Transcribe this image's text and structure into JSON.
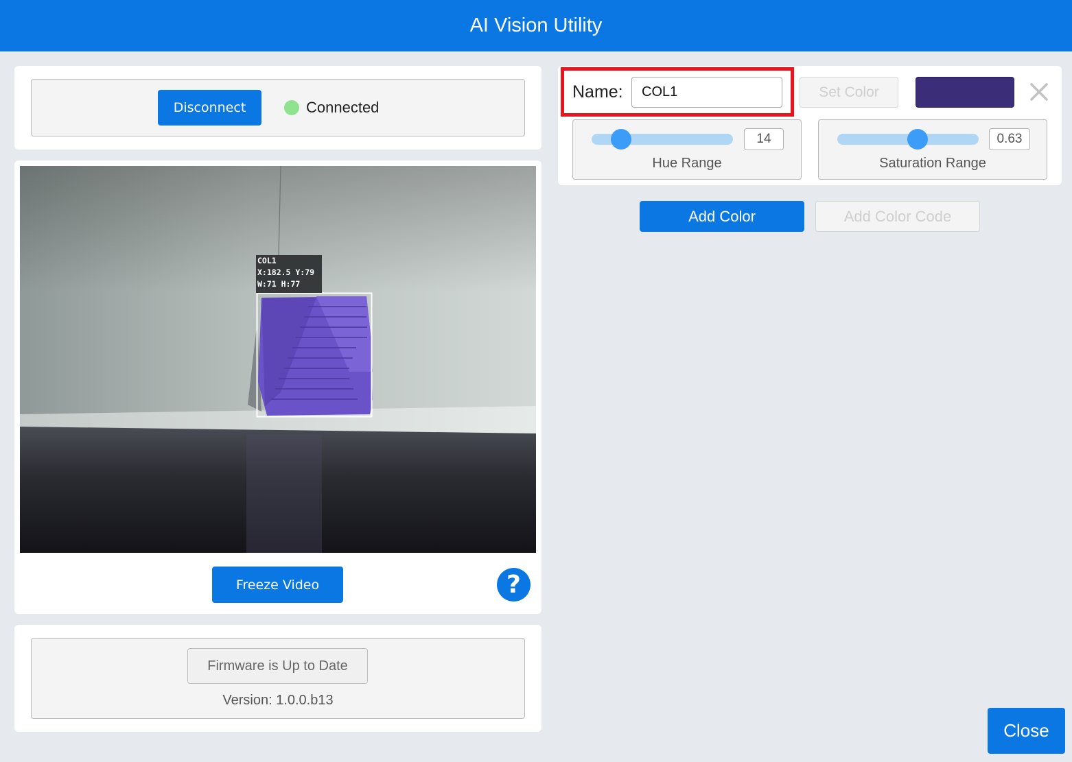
{
  "window": {
    "title": "AI Vision Utility"
  },
  "connection": {
    "disconnect_label": "Disconnect",
    "status_text": "Connected",
    "status_color": "#8fe38f"
  },
  "video": {
    "overlay_lines": [
      "COL1",
      "X:182.5 Y:79",
      "W:71 H:77"
    ],
    "freeze_label": "Freeze Video",
    "help_label": "?"
  },
  "firmware": {
    "status_label": "Firmware is Up to Date",
    "version_text": "Version: 1.0.0.b13"
  },
  "color_editor": {
    "name_label": "Name:",
    "name_value": "COL1",
    "set_color_label": "Set Color",
    "swatch_color": "#3b2d77",
    "remove_icon": "close-x-icon",
    "hue": {
      "label": "Hue Range",
      "value": "14",
      "fraction": 0.21
    },
    "saturation": {
      "label": "Saturation Range",
      "value": "0.63",
      "fraction": 0.57
    }
  },
  "actions": {
    "add_color_label": "Add Color",
    "add_color_code_label": "Add Color Code",
    "close_label": "Close"
  },
  "theme": {
    "accent": "#0b77e3",
    "highlight_border": "#e8151f"
  }
}
